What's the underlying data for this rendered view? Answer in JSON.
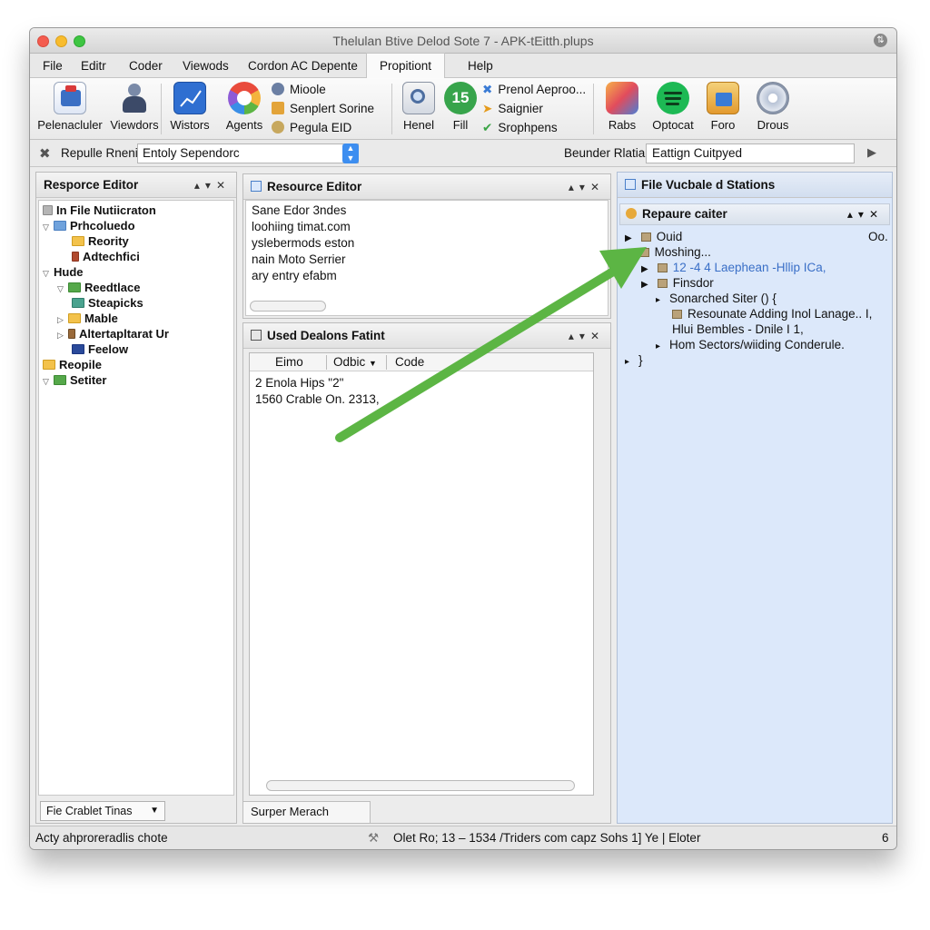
{
  "window": {
    "title": "Thelulan Btive Delod Sote 7 - APK-tEitth.plups"
  },
  "menu": [
    "File",
    "Editr",
    "Coder",
    "Viewods",
    "Cordon AC Depente",
    "Propitiont",
    "Help"
  ],
  "ribbon": {
    "big_left": [
      "Pelenacluler",
      "Viewdors",
      "Wistors",
      "Agents"
    ],
    "small_left": [
      "Mioole",
      "Senplert Sorine",
      "Pegula EID"
    ],
    "big_mid": [
      "Henel",
      "Fill"
    ],
    "small_mid": [
      "Prenol Aeproo...",
      "Saignier",
      "Srophpens"
    ],
    "big_right": [
      "Rabs",
      "Optocat",
      "Foro",
      "Drous"
    ],
    "fill_badge": "15"
  },
  "address": {
    "label": "Repulle Rnenic",
    "value": "Entoly Sependorc",
    "right_label": "Beunder Rlatial",
    "right_value": "Eattign Cuitpyed"
  },
  "left_panel": {
    "title": "Resporce Editor",
    "tree": [
      "In File Nutiicraton",
      "Prhcoluedo",
      "Reority",
      "Adtechfici",
      "Hude",
      "Reedtlace",
      "Steapicks",
      "Mable",
      "Altertapltarat Ur",
      "Feelow",
      "Reopile",
      "Setiter"
    ],
    "dropdown": "Fie Crablet Tinas"
  },
  "resource_editor": {
    "title": "Resource Editor",
    "lines": [
      "Sane Edor 3ndes",
      "loohiing timat.com",
      "yslebermods eston",
      "nain Moto Serrier",
      "ary entry efabm"
    ]
  },
  "used_panel": {
    "title": "Used Dealons Fatint",
    "columns": [
      "Eimo",
      "Odbic",
      "Code"
    ],
    "rows": [
      "2 Enola Hips  \"2\"",
      "1560 Crable On. 2313,"
    ],
    "tab": "Surper Merach"
  },
  "right_panel": {
    "title": "File Vucbale d Stations",
    "sub_title": "Repaure caiter",
    "rows": [
      {
        "text": "Ouid",
        "extra": "Oo."
      },
      {
        "text": "Moshing..."
      },
      {
        "text": "12 -4 4 Laephean -Hllip ICa,"
      },
      {
        "text": "Finsdor"
      },
      {
        "text": "Sonarched Siter ()  {"
      },
      {
        "text": "Resounate Adding Inol Lanage..  I,"
      },
      {
        "text": "Hlui Bembles   -  Dnile I 1,"
      },
      {
        "text": "Hom Sectors/wiiding Conderule."
      },
      {
        "text": "}"
      }
    ]
  },
  "status": {
    "left": "Acty ahproreradlis chote",
    "middle": "Olet Ro; 13 – 1534 /Triders com capz Sohs 1] Ye | Eloter",
    "right": "6"
  },
  "colors": {
    "accent": "#3d8ef0",
    "arrow": "#5cb544",
    "right_panel_bg": "#dce8fa"
  }
}
